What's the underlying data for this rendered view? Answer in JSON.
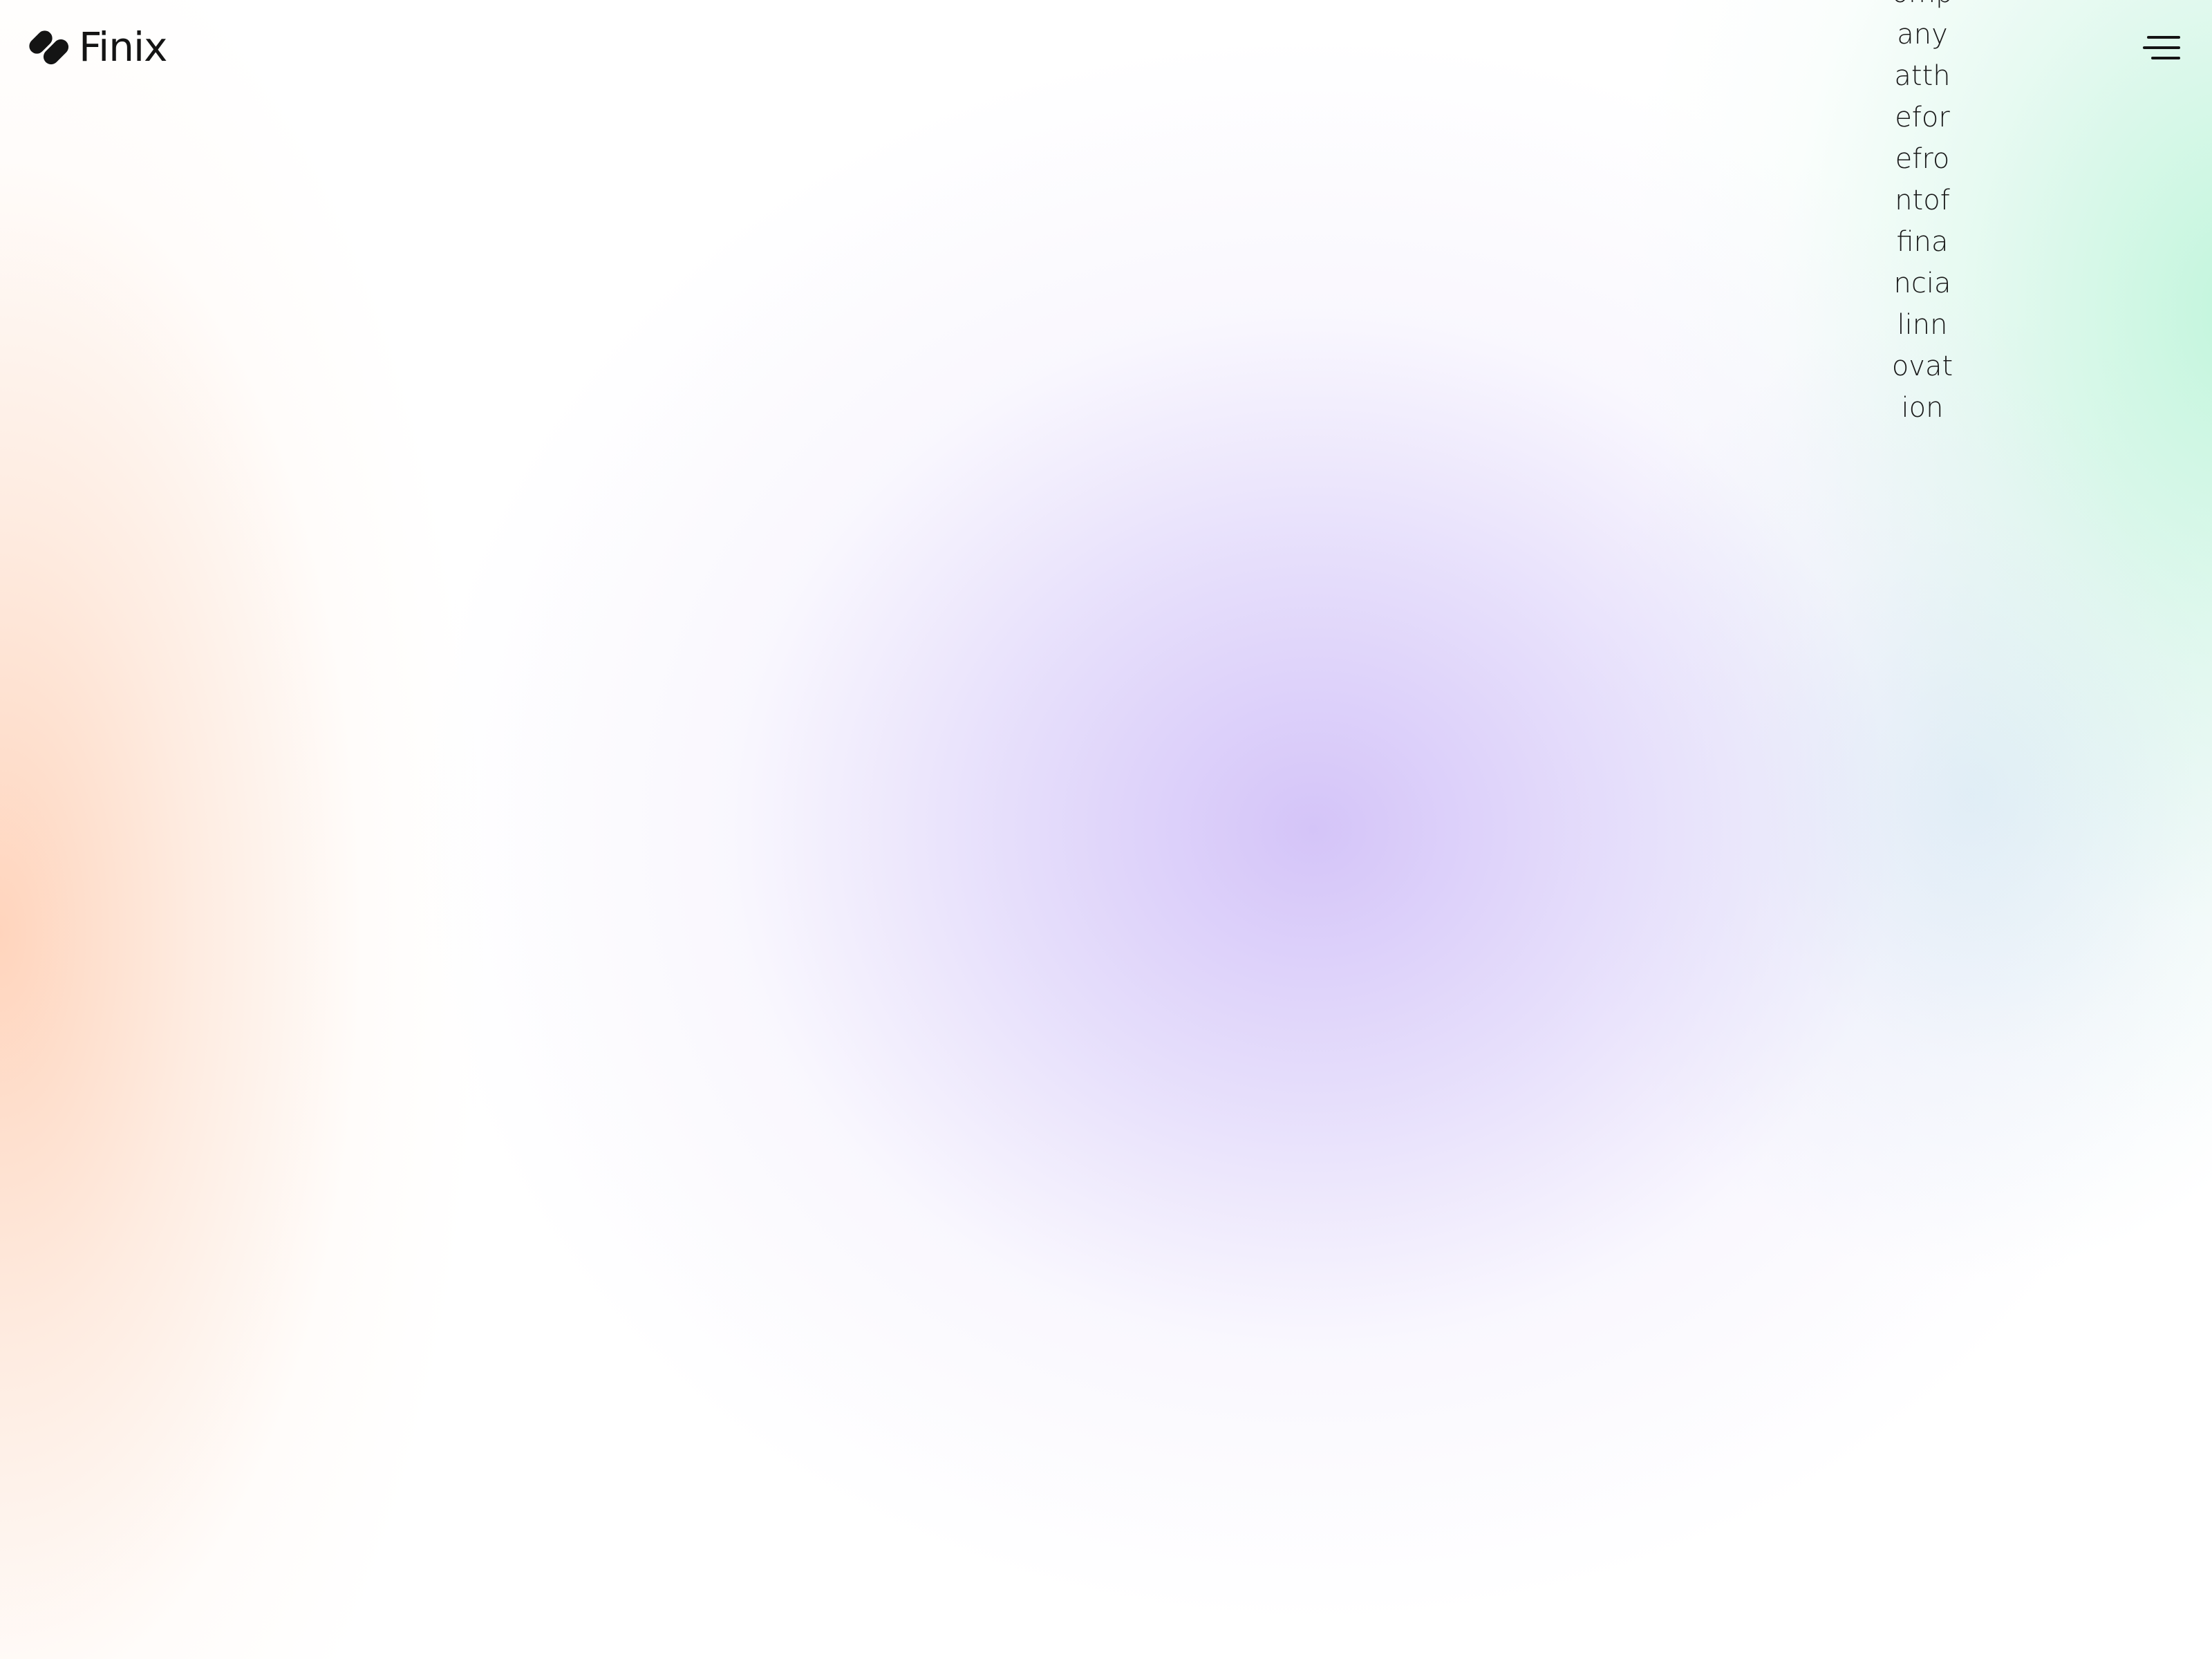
{
  "brand": {
    "name": "Finix",
    "logo_icon": "finix-logo-icon"
  },
  "header": {
    "menu_icon": "hamburger-menu-icon"
  },
  "hero": {
    "vertical_text": "ompanyattheforefrontoffinancialinnovation"
  },
  "colors": {
    "text": "#141414",
    "glow_purple": "#d8c8f6",
    "glow_peach": "#ffd2b9",
    "glow_mint": "#bef5da",
    "background": "#ffffff"
  }
}
